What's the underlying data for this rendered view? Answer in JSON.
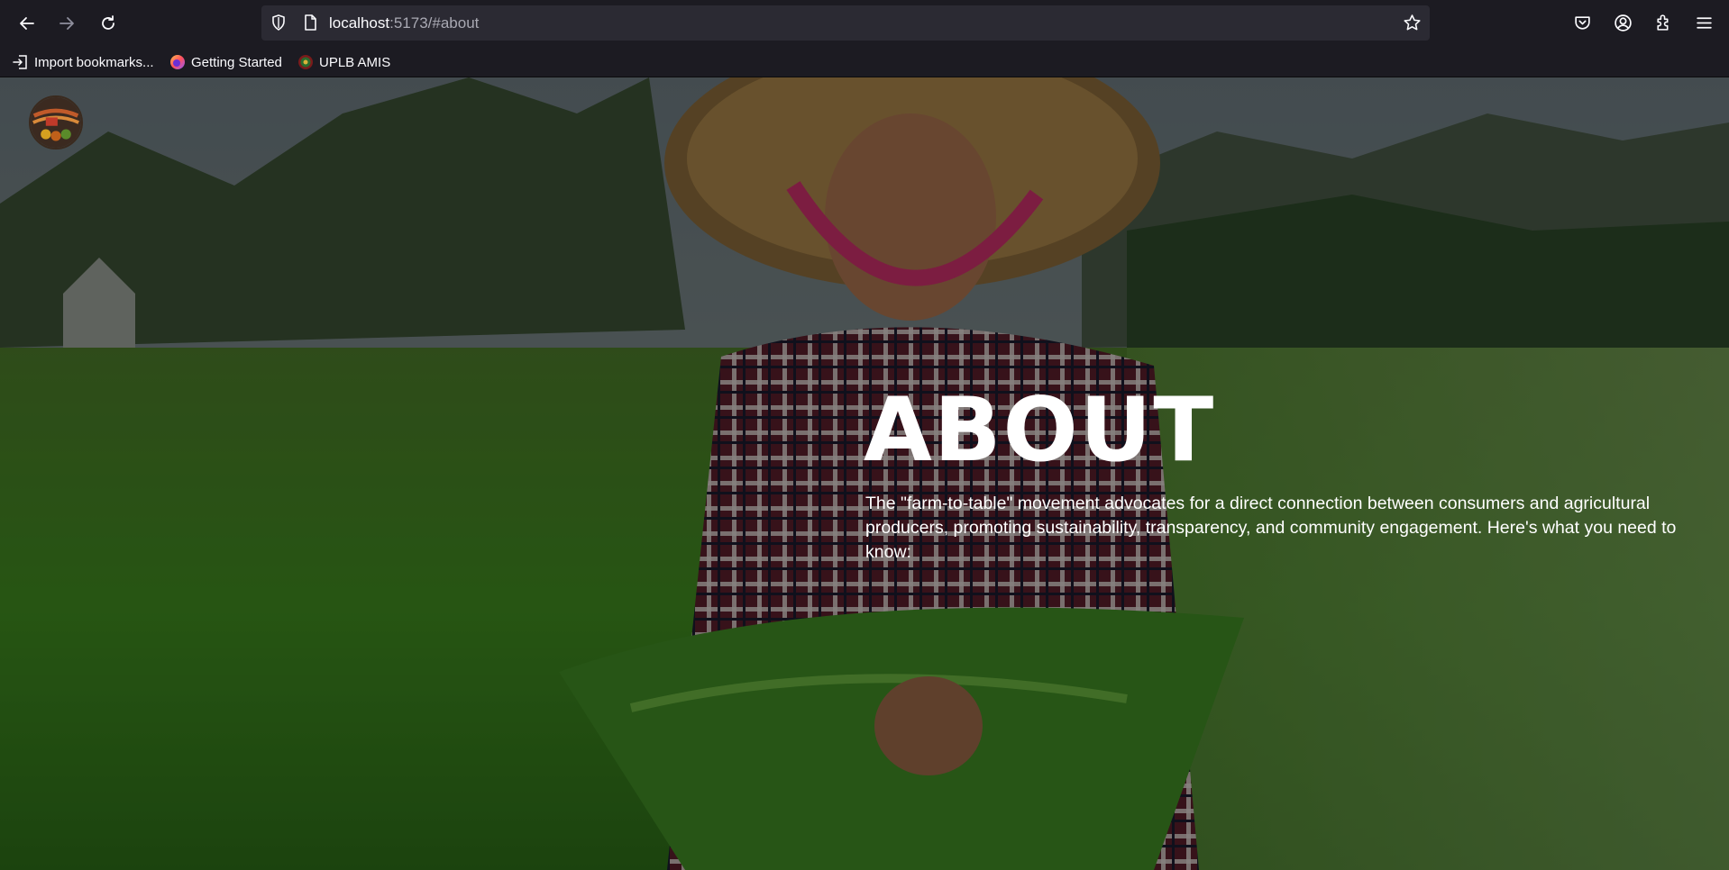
{
  "browser": {
    "url_host": "localhost",
    "url_rest": ":5173/#about",
    "bookmarks": [
      {
        "label": "Import bookmarks...",
        "icon": "import-icon"
      },
      {
        "label": "Getting Started",
        "icon": "firefox-icon"
      },
      {
        "label": "UPLB AMIS",
        "icon": "uplb-seal-icon"
      }
    ]
  },
  "page": {
    "title": "ABOUT",
    "description": "The \"farm-to-table\" movement advocates for a direct connection between consumers and agricultural producers, promoting sustainability, transparency, and community engagement. Here's what you need to know:"
  },
  "colors": {
    "chrome": "#1c1b22",
    "urlbar": "#2b2a33",
    "text": "#ffffff"
  }
}
